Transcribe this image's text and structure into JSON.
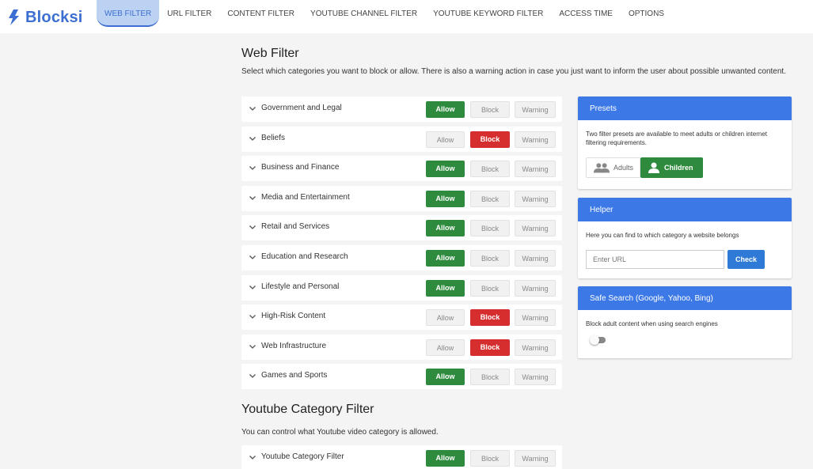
{
  "brand": {
    "name": "Blocksi",
    "accent": "#3c6fd1"
  },
  "nav": [
    {
      "label": "WEB FILTER",
      "active": true
    },
    {
      "label": "URL FILTER"
    },
    {
      "label": "CONTENT FILTER"
    },
    {
      "label": "YOUTUBE CHANNEL FILTER"
    },
    {
      "label": "YOUTUBE KEYWORD FILTER"
    },
    {
      "label": "ACCESS TIME"
    },
    {
      "label": "OPTIONS"
    }
  ],
  "web_filter": {
    "title": "Web Filter",
    "description": "Select which categories you want to block or allow. There is also a warning action in case you just want to inform the user about possible unwanted content.",
    "buttons": {
      "allow": "Allow",
      "block": "Block",
      "warning": "Warning"
    },
    "categories": [
      {
        "label": "Government and Legal",
        "state": "allow"
      },
      {
        "label": "Beliefs",
        "state": "block"
      },
      {
        "label": "Business and Finance",
        "state": "allow"
      },
      {
        "label": "Media and Entertainment",
        "state": "allow"
      },
      {
        "label": "Retail and Services",
        "state": "allow"
      },
      {
        "label": "Education and Research",
        "state": "allow"
      },
      {
        "label": "Lifestyle and Personal",
        "state": "allow"
      },
      {
        "label": "High-Risk Content",
        "state": "block"
      },
      {
        "label": "Web Infrastructure",
        "state": "block"
      },
      {
        "label": "Games and Sports",
        "state": "allow"
      }
    ]
  },
  "youtube_filter": {
    "title": "Youtube Category Filter",
    "description": "You can control what Youtube video category is allowed.",
    "categories": [
      {
        "label": "Youtube Category Filter",
        "state": "allow"
      }
    ]
  },
  "presets": {
    "title": "Presets",
    "text": "Two filter presets are available to meet adults or children internet filtering requirements.",
    "adults_label": "Adults",
    "children_label": "Children",
    "selected": "children"
  },
  "helper": {
    "title": "Helper",
    "text": "Here you can find to which category a website belongs",
    "url_placeholder": "Enter URL",
    "check_label": "Check"
  },
  "safe_search": {
    "title": "Safe Search (Google, Yahoo, Bing)",
    "text": "Block adult content when using search engines",
    "enabled": false
  },
  "colors": {
    "allow": "#2e8b3e",
    "block": "#d62e2e",
    "header_blue": "#3c79e6"
  }
}
